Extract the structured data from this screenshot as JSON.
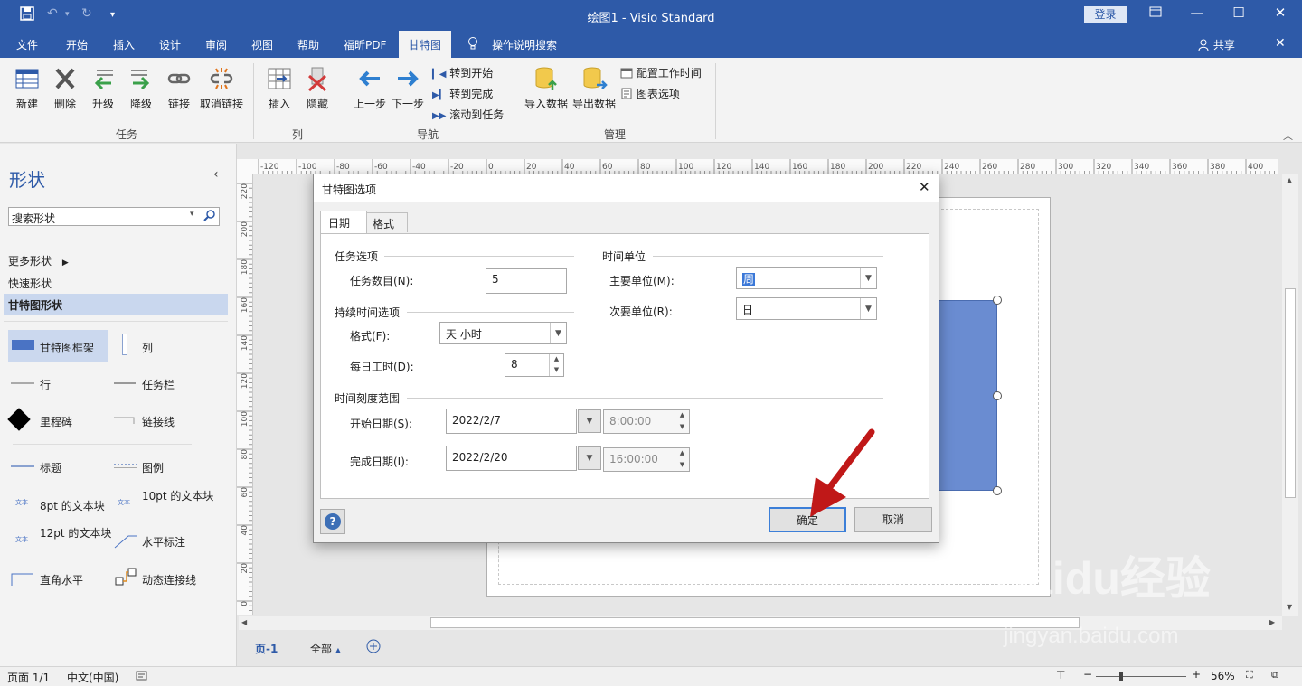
{
  "window": {
    "title": "绘图1 - Visio Standard",
    "login_label": "登录",
    "share_label": "共享"
  },
  "tabs": [
    "文件",
    "开始",
    "插入",
    "设计",
    "审阅",
    "视图",
    "帮助",
    "福昕PDF",
    "甘特图",
    "操作说明搜索"
  ],
  "active_tab": "甘特图",
  "ribbon": {
    "task": {
      "label": "任务",
      "buttons": [
        "新建",
        "删除",
        "升级",
        "降级",
        "链接",
        "取消链接"
      ]
    },
    "column": {
      "label": "列",
      "buttons": [
        "插入",
        "隐藏"
      ]
    },
    "nav": {
      "label": "导航",
      "prev": "上一步",
      "next": "下一步",
      "go_start": "转到开始",
      "go_finish": "转到完成",
      "scroll_task": "滚动到任务"
    },
    "manage": {
      "label": "管理",
      "import": "导入数据",
      "export": "导出数据",
      "config_time": "配置工作时间",
      "chart_options": "图表选项"
    }
  },
  "shapes_panel": {
    "title": "形状",
    "search_placeholder": "搜索形状",
    "more_shapes": "更多形状",
    "quick_shapes": "快速形状",
    "gantt_shapes": "甘特图形状",
    "items": [
      "甘特图框架",
      "列",
      "行",
      "任务栏",
      "里程碑",
      "链接线",
      "标题",
      "图例",
      "8pt 的文本块",
      "10pt 的文本块",
      "12pt 的文本块",
      "水平标注",
      "直角水平",
      "动态连接线"
    ]
  },
  "ruler_h": [
    "-120",
    "-100",
    "-80",
    "-60",
    "-40",
    "-20",
    "0",
    "20",
    "40",
    "60",
    "80",
    "100",
    "120",
    "140",
    "160",
    "180",
    "200",
    "220",
    "240",
    "260",
    "280",
    "300",
    "320",
    "340",
    "360",
    "380",
    "400"
  ],
  "ruler_v": [
    "220",
    "200",
    "180",
    "160",
    "140",
    "120",
    "100",
    "80",
    "60",
    "40",
    "20",
    "0"
  ],
  "dialog": {
    "title": "甘特图选项",
    "tab_date": "日期",
    "tab_format": "格式",
    "task_options": "任务选项",
    "task_count_label": "任务数目(N):",
    "task_count": "5",
    "duration_options": "持续时间选项",
    "format_label": "格式(F):",
    "format_value": "天 小时",
    "hours_label": "每日工时(D):",
    "hours_value": "8",
    "time_units": "时间单位",
    "major_label": "主要单位(M):",
    "major_value": "周",
    "minor_label": "次要单位(R):",
    "minor_value": "日",
    "timescale_range": "时间刻度范围",
    "start_label": "开始日期(S):",
    "start_date": "2022/2/7",
    "start_time": "8:00:00",
    "finish_label": "完成日期(I):",
    "finish_date": "2022/2/20",
    "finish_time": "16:00:00",
    "ok": "确定",
    "cancel": "取消",
    "help_icon": "?"
  },
  "page_tabs": {
    "page": "页-1",
    "all": "全部"
  },
  "status": {
    "page": "页面 1/1",
    "lang": "中文(中国)",
    "zoom": "56%"
  },
  "watermark": {
    "brand": "Baidu经验",
    "url": "jingyan.baidu.com"
  },
  "colors": {
    "accent": "#2e5aa8",
    "shape_fill": "#6a8cd1",
    "arrow": "#c01818"
  }
}
